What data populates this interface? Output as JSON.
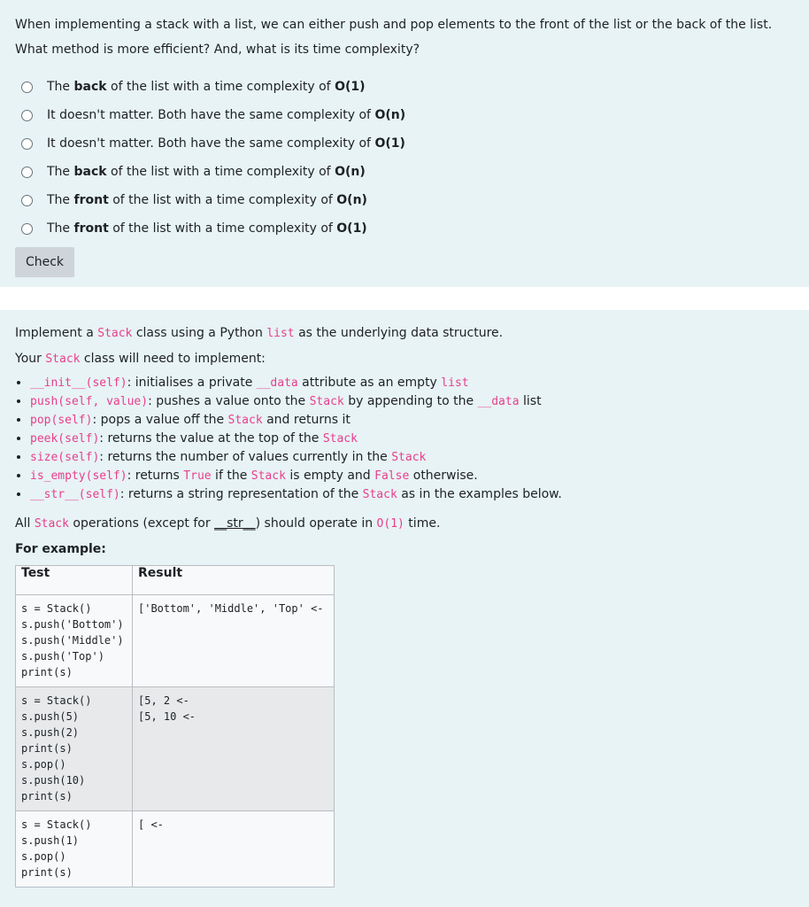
{
  "q1": {
    "prompt_line1": "When implementing a stack with a list, we can either push and pop elements to the front of the list or the back of the list.",
    "prompt_line2": "What method is more efficient? And, what is its time complexity?",
    "options": [
      {
        "pre": "The ",
        "bold": "back",
        "mid": " of the list with a time complexity of ",
        "bold2": "O(1)"
      },
      {
        "pre": "It doesn't matter. Both have the same complexity of ",
        "bold": "",
        "mid": "",
        "bold2": "O(n)"
      },
      {
        "pre": "It doesn't matter. Both have the same complexity of ",
        "bold": "",
        "mid": "",
        "bold2": "O(1)"
      },
      {
        "pre": "The ",
        "bold": "back",
        "mid": " of the list with a time complexity of ",
        "bold2": "O(n)"
      },
      {
        "pre": "The ",
        "bold": "front",
        "mid": " of the list with a time complexity of ",
        "bold2": "O(n)"
      },
      {
        "pre": "The ",
        "bold": "front",
        "mid": " of the list with a time complexity of ",
        "bold2": "O(1)"
      }
    ],
    "check_label": "Check"
  },
  "q2": {
    "intro": {
      "t1": "Implement a ",
      "c1": "Stack",
      "t2": " class using a Python ",
      "c2": "list",
      "t3": " as the underlying data structure."
    },
    "need": {
      "t1": "Your ",
      "c1": "Stack",
      "t2": " class will need to implement:"
    },
    "methods": [
      [
        {
          "c": "__init__(self)"
        },
        {
          "t": ": initialises a private "
        },
        {
          "c": "__data"
        },
        {
          "t": " attribute as an empty "
        },
        {
          "c": "list"
        }
      ],
      [
        {
          "c": "push(self, value)"
        },
        {
          "t": ": pushes a value onto the "
        },
        {
          "c": "Stack"
        },
        {
          "t": " by appending to the "
        },
        {
          "c": "__data"
        },
        {
          "t": " list"
        }
      ],
      [
        {
          "c": "pop(self)"
        },
        {
          "t": ": pops a value off the "
        },
        {
          "c": "Stack"
        },
        {
          "t": " and returns it"
        }
      ],
      [
        {
          "c": "peek(self)"
        },
        {
          "t": ": returns the value at the top of the "
        },
        {
          "c": "Stack"
        }
      ],
      [
        {
          "c": "size(self)"
        },
        {
          "t": ": returns the number of values currently in the "
        },
        {
          "c": "Stack"
        }
      ],
      [
        {
          "c": "is_empty(self)"
        },
        {
          "t": ": returns "
        },
        {
          "c": "True"
        },
        {
          "t": " if the "
        },
        {
          "c": "Stack"
        },
        {
          "t": " is empty and "
        },
        {
          "c": "False"
        },
        {
          "t": " otherwise."
        }
      ],
      [
        {
          "c": "__str__(self)"
        },
        {
          "t": ": returns a string representation of the "
        },
        {
          "c": "Stack"
        },
        {
          "t": " as in the examples below."
        }
      ]
    ],
    "ops": {
      "t1": "All ",
      "c1": "Stack",
      "t2": " operations (except for ",
      "c2": "__str__",
      "t3": ") should operate in ",
      "c3": "O(1)",
      "t4": " time."
    },
    "for_example": "For example:",
    "table": {
      "headers": [
        "Test",
        "Result"
      ],
      "rows": [
        {
          "test": "s = Stack()\ns.push('Bottom')\ns.push('Middle')\ns.push('Top')\nprint(s)",
          "result": "['Bottom', 'Middle', 'Top' <-"
        },
        {
          "test": "s = Stack()\ns.push(5)\ns.push(2)\nprint(s)\ns.pop()\ns.push(10)\nprint(s)",
          "result": "[5, 2 <-\n[5, 10 <-"
        },
        {
          "test": "s = Stack()\ns.push(1)\ns.pop()\nprint(s)",
          "result": "[ <-"
        }
      ]
    }
  }
}
